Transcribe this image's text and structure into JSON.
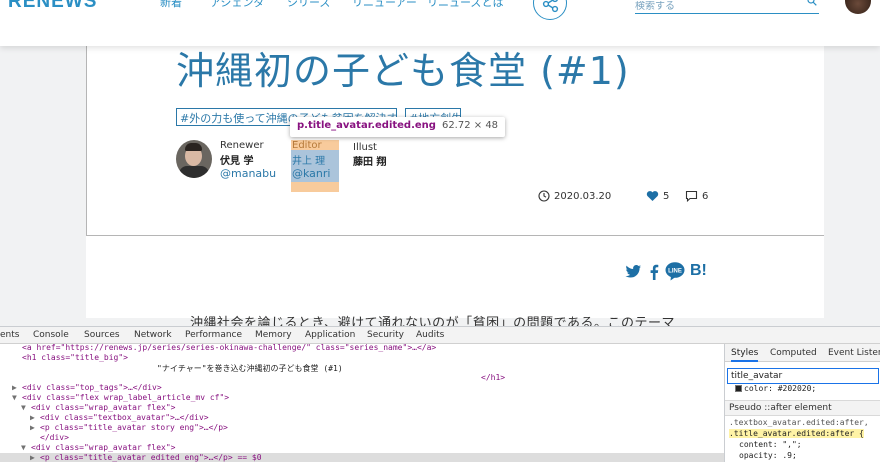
{
  "site": {
    "logo": "RENEWS",
    "nav": [
      "新着",
      "アジェンダ",
      "シリーズ",
      "リニューアー",
      "リニューズとは"
    ],
    "search_placeholder": "検索する"
  },
  "article": {
    "title": "沖縄初の子ども食堂 (#1)",
    "tags": [
      "#外の力も使って沖縄の子ども貧困を解決する",
      "#地方創生"
    ],
    "tooltip": {
      "selector": "p.title_avatar.edited.eng",
      "size": "62.72 × 48"
    },
    "authors": [
      {
        "role": "Renewer",
        "name": "伏見 学",
        "handle": "@manabu"
      },
      {
        "role": "Editor",
        "name": "井上 理",
        "handle": "@kanri"
      },
      {
        "role": "Illust",
        "name": "藤田 翔"
      }
    ],
    "date": "2020.03.20",
    "likes": "5",
    "comments": "6",
    "hatena": "B!",
    "body_preview": "沖縄社会を論じるとき、避けて通れないのが「貧困」の問題である。このテーマ"
  },
  "devtools": {
    "tabs": [
      "ents",
      "Console",
      "Sources",
      "Network",
      "Performance",
      "Memory",
      "Application",
      "Security",
      "Audits"
    ],
    "dom": [
      {
        "indent": 2,
        "tri": "",
        "tag": "<a href=\"https://renews.jp/series/series-okinawa-challenge/\" class=\"series_name\">…</a>"
      },
      {
        "indent": 2,
        "tri": "",
        "tag": "<h1 class=\"title_big\">"
      },
      {
        "indent": 17,
        "tri": "",
        "tag": "\"ナイチャー\"を巻き込む沖縄初の子ども食堂 (#1)"
      },
      {
        "indent": 53,
        "tri": "",
        "tag": "</h1>"
      },
      {
        "indent": 2,
        "tri": "▶",
        "tag": "<div class=\"top_tags\">…</div>"
      },
      {
        "indent": 2,
        "tri": "▼",
        "tag": "<div class=\"flex wrap_label_article_mv cf\">"
      },
      {
        "indent": 3,
        "tri": "▼",
        "tag": "<div class=\"wrap_avatar flex\">"
      },
      {
        "indent": 4,
        "tri": "▶",
        "tag": "<div class=\"textbox_avatar\">…</div>"
      },
      {
        "indent": 4,
        "tri": "▶",
        "tag": "<p class=\"title_avatar story eng\">…</p>"
      },
      {
        "indent": 4,
        "tri": "",
        "tag": "</div>"
      },
      {
        "indent": 3,
        "tri": "▼",
        "tag": "<div class=\"wrap_avatar flex\">"
      },
      {
        "indent": 4,
        "tri": "▶",
        "tag": "<p class=\"title_avatar edited eng\">…</p> == $0"
      }
    ],
    "side_tabs": [
      "Styles",
      "Computed",
      "Event Listeners"
    ],
    "filter": "title_avatar",
    "color_rule": "color: #202020;",
    "pseudo_header": "Pseudo ::after element",
    "rule_lines": [
      ".textbox_avatar.edited:after,",
      ".title_avatar.edited:after {",
      "content: \",\";",
      "opacity: .9;"
    ]
  }
}
